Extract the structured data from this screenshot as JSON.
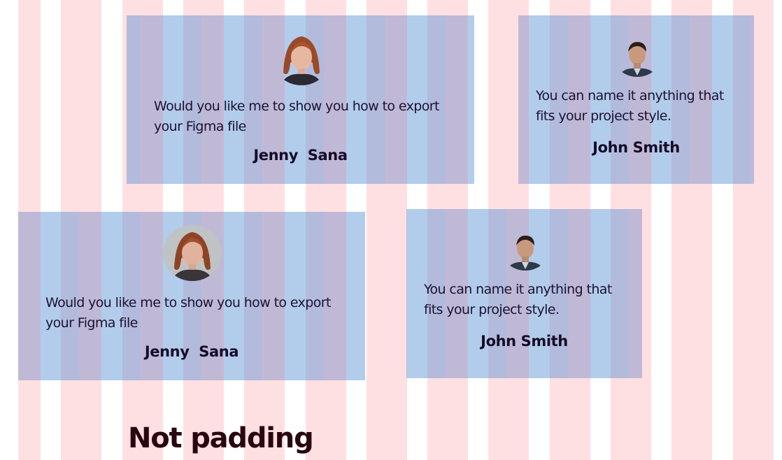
{
  "colors": {
    "grid_column": "#ffe0e2",
    "card_fill": "#a6c3e8",
    "card_overlay": "#b0abcf",
    "text": "#1c1230",
    "footer_text": "#2a0610"
  },
  "cards": [
    {
      "avatar": "woman-avatar",
      "message": "Would you like me to show you how to export your Figma file",
      "name": "Jenny  Sana"
    },
    {
      "avatar": "man-avatar",
      "message": "You can name it anything that fits your project style.",
      "name": "John Smith"
    },
    {
      "avatar": "woman-avatar",
      "message": "Would you like me to show you how to export your Figma file",
      "name": "Jenny  Sana"
    },
    {
      "avatar": "man-avatar",
      "message": "You can name it anything that fits your project style.",
      "name": "John Smith"
    }
  ],
  "footer": {
    "label": "Not padding"
  }
}
